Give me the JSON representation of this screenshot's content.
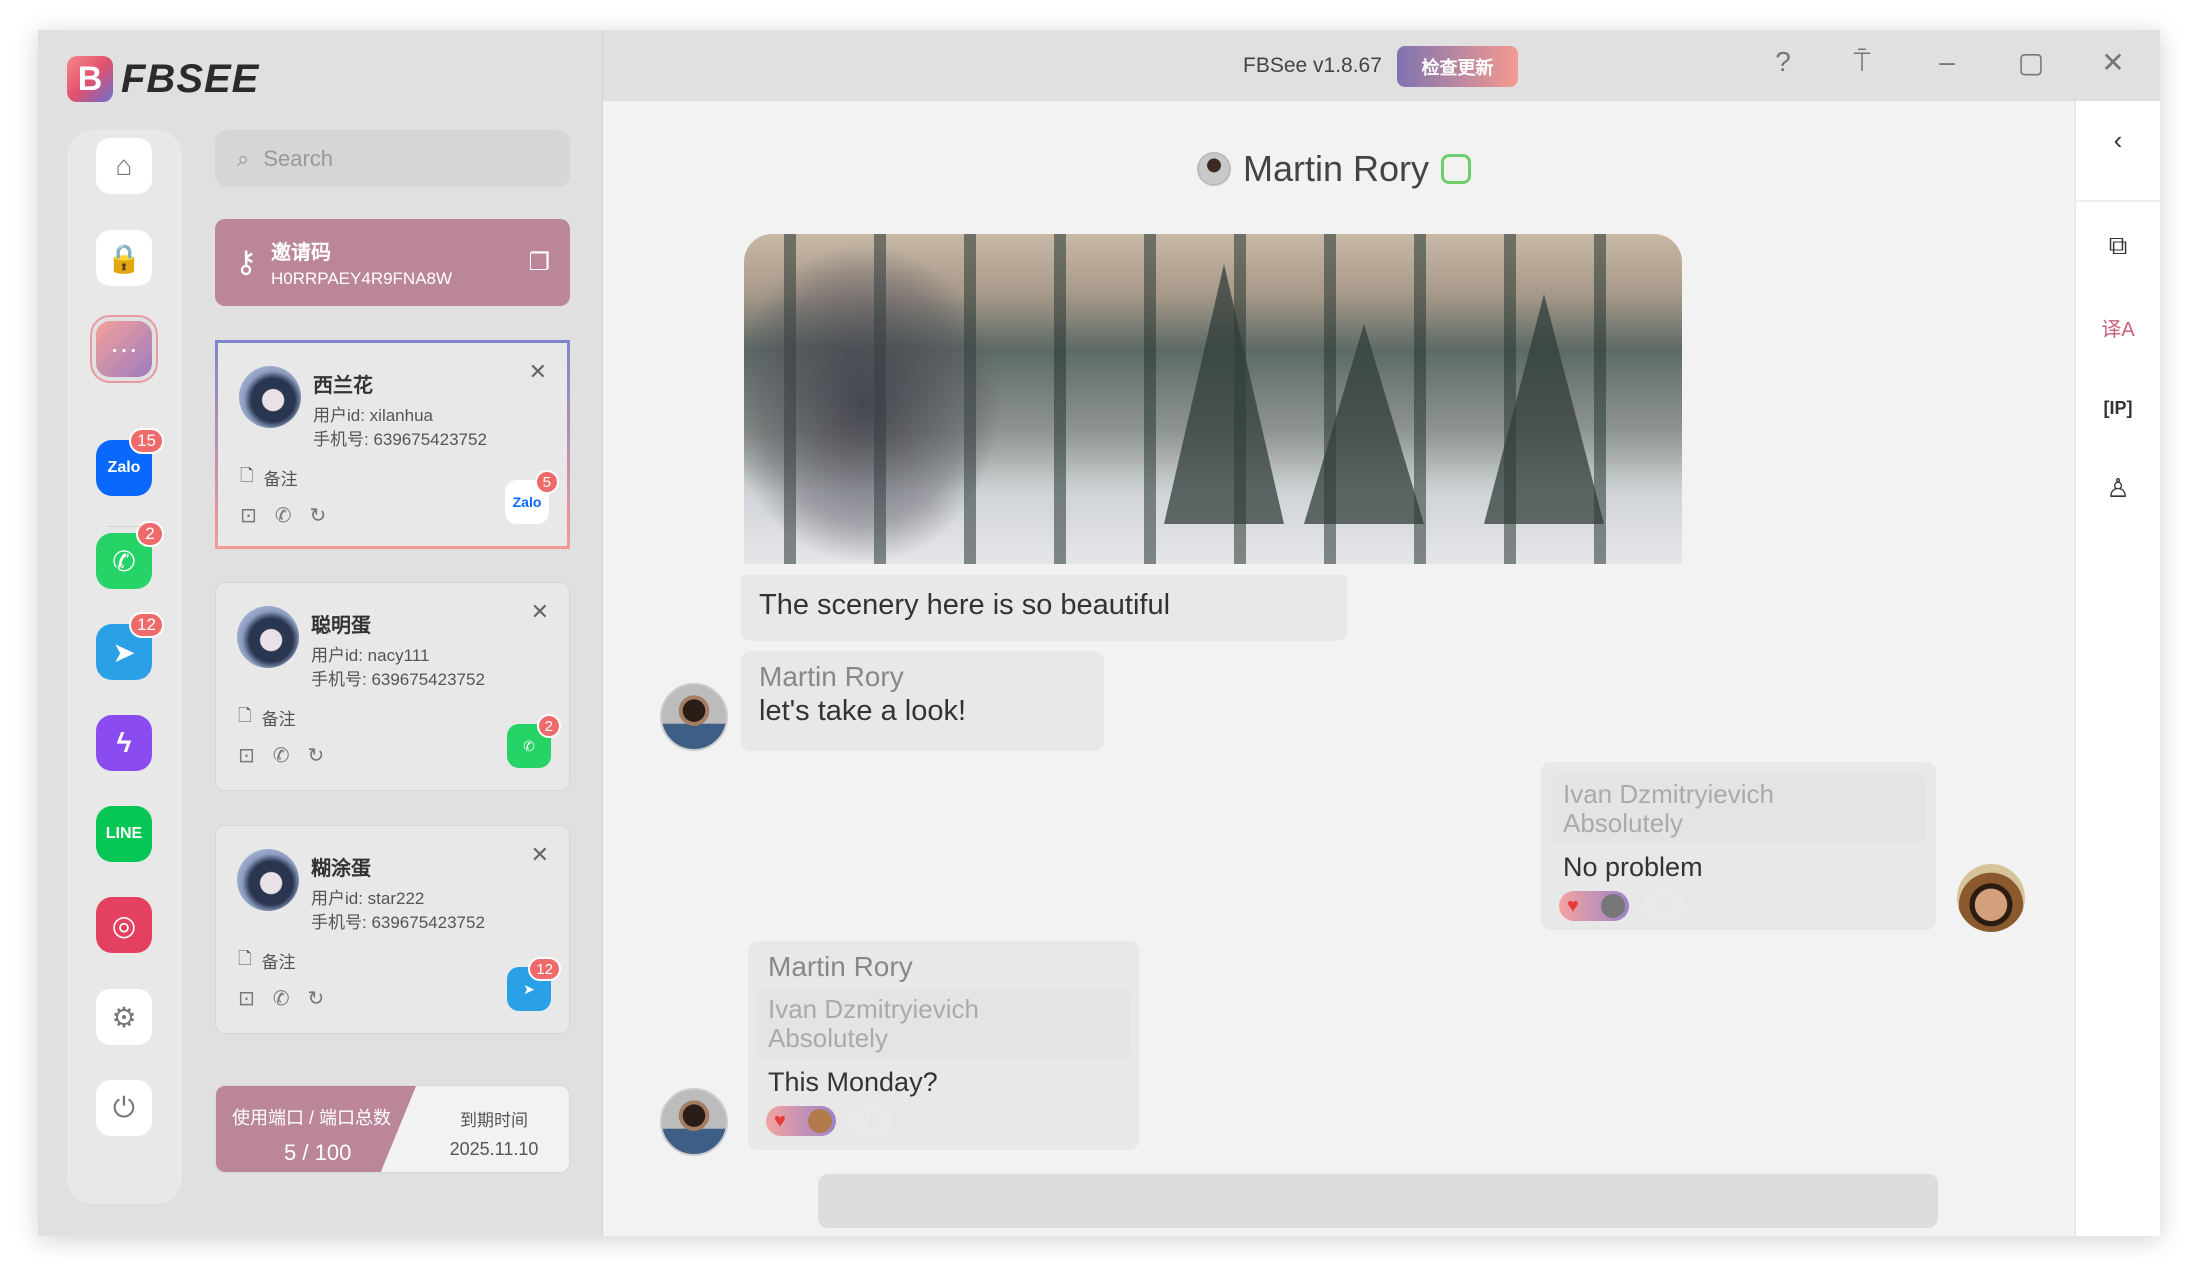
{
  "app": {
    "logo": "FBSEE",
    "version": "FBSee v1.8.67",
    "update_button": "检查更新"
  },
  "window_controls": [
    "help-icon",
    "pin-icon",
    "minimize-icon",
    "maximize-icon",
    "close-icon"
  ],
  "rail": {
    "items": [
      {
        "name": "home",
        "icon": "⌂"
      },
      {
        "name": "lock",
        "icon": "🔒"
      },
      {
        "name": "chat",
        "icon": "···",
        "active": true
      },
      {
        "name": "zalo",
        "label": "Zalo",
        "badge": "15",
        "color": "#0a68ff"
      },
      {
        "name": "whatsapp",
        "label": "✆",
        "badge": "2",
        "color": "#25d366"
      },
      {
        "name": "telegram",
        "label": "➤",
        "badge": "12",
        "color": "#2aa1e6"
      },
      {
        "name": "messenger",
        "label": "ϟ",
        "color": "#8a4cf0"
      },
      {
        "name": "line",
        "label": "LINE",
        "color": "#06c755"
      },
      {
        "name": "instagram",
        "label": "◎",
        "color": "#e4405f"
      },
      {
        "name": "settings",
        "icon": "⚙"
      },
      {
        "name": "power",
        "icon": "⏻"
      }
    ]
  },
  "search": {
    "placeholder": "Search"
  },
  "invite": {
    "title": "邀请码",
    "code": "H0RRPAEY4R9FNA8W"
  },
  "contacts": [
    {
      "name": "西兰花",
      "user_id": "用户id: xilanhua",
      "phone": "手机号: 639675423752",
      "note": "备注",
      "app": "Zalo",
      "badge": "5",
      "color": "#ffffff",
      "fg": "#0a68ff",
      "selected": true
    },
    {
      "name": "聪明蛋",
      "user_id": "用户id: nacy111",
      "phone": "手机号: 639675423752",
      "note": "备注",
      "app": "✆",
      "badge": "2",
      "color": "#25d366",
      "fg": "#fff"
    },
    {
      "name": "糊涂蛋",
      "user_id": "用户id: star222",
      "phone": "手机号: 639675423752",
      "note": "备注",
      "app": "➤",
      "badge": "12",
      "color": "#2aa1e6",
      "fg": "#fff"
    }
  ],
  "ports": {
    "label": "使用端口 / 端口总数",
    "used": "5",
    "total": "100",
    "expiry_label": "到期时间",
    "expiry": "2025.11.10"
  },
  "chat": {
    "title": "Martin Rory",
    "messages": [
      {
        "text": "The scenery here is so beautiful"
      },
      {
        "sender": "Martin Rory",
        "text": "let's take a look!"
      },
      {
        "quote_sender": "Ivan Dzmitryievich",
        "quote_text": "Absolutely",
        "text": "No problem"
      },
      {
        "sender": "Martin Rory",
        "quote_sender": "Ivan Dzmitryievich",
        "quote_text": "Absolutely",
        "text": "This Monday?"
      }
    ]
  },
  "right_tools": [
    "back-icon",
    "quick-reply-icon",
    "translate-icon",
    "ip-icon",
    "contact-favorite-icon"
  ]
}
